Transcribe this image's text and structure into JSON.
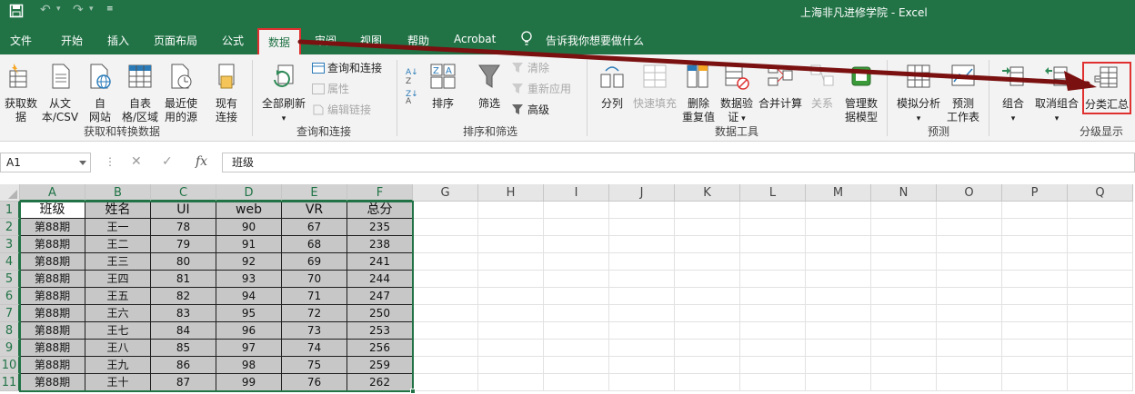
{
  "window": {
    "title": "上海非凡进修学院  -  Excel"
  },
  "tabs": [
    {
      "label": "文件"
    },
    {
      "label": "开始"
    },
    {
      "label": "插入"
    },
    {
      "label": "页面布局"
    },
    {
      "label": "公式"
    },
    {
      "label": "数据"
    },
    {
      "label": "审阅"
    },
    {
      "label": "视图"
    },
    {
      "label": "帮助"
    },
    {
      "label": "Acrobat"
    },
    {
      "label": "告诉我你想要做什么"
    }
  ],
  "active_tab": "数据",
  "ribbon": {
    "get_data": {
      "group_label": "获取和转换数据",
      "get_data_btn": [
        "获取数",
        "据"
      ],
      "from_text_btn": [
        "从文",
        "本/CSV"
      ],
      "from_web_btn": [
        "自",
        "网站"
      ],
      "from_table_btn": [
        "自表",
        "格/区域"
      ],
      "recent_sources_btn": [
        "最近使",
        "用的源"
      ],
      "existing_conn_btn": [
        "现有",
        "连接"
      ]
    },
    "queries": {
      "group_label": "查询和连接",
      "refresh_all_btn": "全部刷新",
      "queries_connections": "查询和连接",
      "properties": "属性",
      "edit_links": "编辑链接"
    },
    "sort_filter": {
      "group_label": "排序和筛选",
      "sort_btn": "排序",
      "filter_btn": "筛选",
      "clear": "清除",
      "reapply": "重新应用",
      "advanced": "高级"
    },
    "data_tools": {
      "group_label": "数据工具",
      "text_to_columns": "分列",
      "flash_fill": "快速填充",
      "remove_duplicates": [
        "删除",
        "重复值"
      ],
      "data_validation": [
        "数据验",
        "证"
      ],
      "consolidate": "合并计算",
      "relationships": "关系",
      "manage_model": [
        "管理数",
        "据模型"
      ]
    },
    "forecast": {
      "group_label": "预测",
      "what_if": "模拟分析",
      "forecast_sheet": [
        "预测",
        "工作表"
      ]
    },
    "outline": {
      "group_label": "分级显示",
      "group_btn": "组合",
      "ungroup_btn": "取消组合",
      "subtotal_btn": "分类汇总"
    }
  },
  "formula_bar": {
    "name_box": "A1",
    "formula": "班级",
    "fx": "fx"
  },
  "grid": {
    "columns": [
      "A",
      "B",
      "C",
      "D",
      "E",
      "F",
      "G",
      "H",
      "I",
      "J",
      "K",
      "L",
      "M",
      "N",
      "O",
      "P",
      "Q"
    ],
    "rows": [
      "1",
      "2",
      "3",
      "4",
      "5",
      "6",
      "7",
      "8",
      "9",
      "10",
      "11"
    ],
    "cells": [
      [
        "班级",
        "姓名",
        "UI",
        "web",
        "VR",
        "总分"
      ],
      [
        "第88期",
        "王一",
        "78",
        "90",
        "67",
        "235"
      ],
      [
        "第88期",
        "王二",
        "79",
        "91",
        "68",
        "238"
      ],
      [
        "第88期",
        "王三",
        "80",
        "92",
        "69",
        "241"
      ],
      [
        "第88期",
        "王四",
        "81",
        "93",
        "70",
        "244"
      ],
      [
        "第88期",
        "王五",
        "82",
        "94",
        "71",
        "247"
      ],
      [
        "第88期",
        "王六",
        "83",
        "95",
        "72",
        "250"
      ],
      [
        "第88期",
        "王七",
        "84",
        "96",
        "73",
        "253"
      ],
      [
        "第88期",
        "王八",
        "85",
        "97",
        "74",
        "256"
      ],
      [
        "第88期",
        "王九",
        "86",
        "98",
        "75",
        "259"
      ],
      [
        "第88期",
        "王十",
        "87",
        "99",
        "76",
        "262"
      ]
    ]
  },
  "colors": {
    "excel_green": "#217346",
    "highlight_red": "#e03030",
    "arrow_darkred": "#7a1010"
  }
}
